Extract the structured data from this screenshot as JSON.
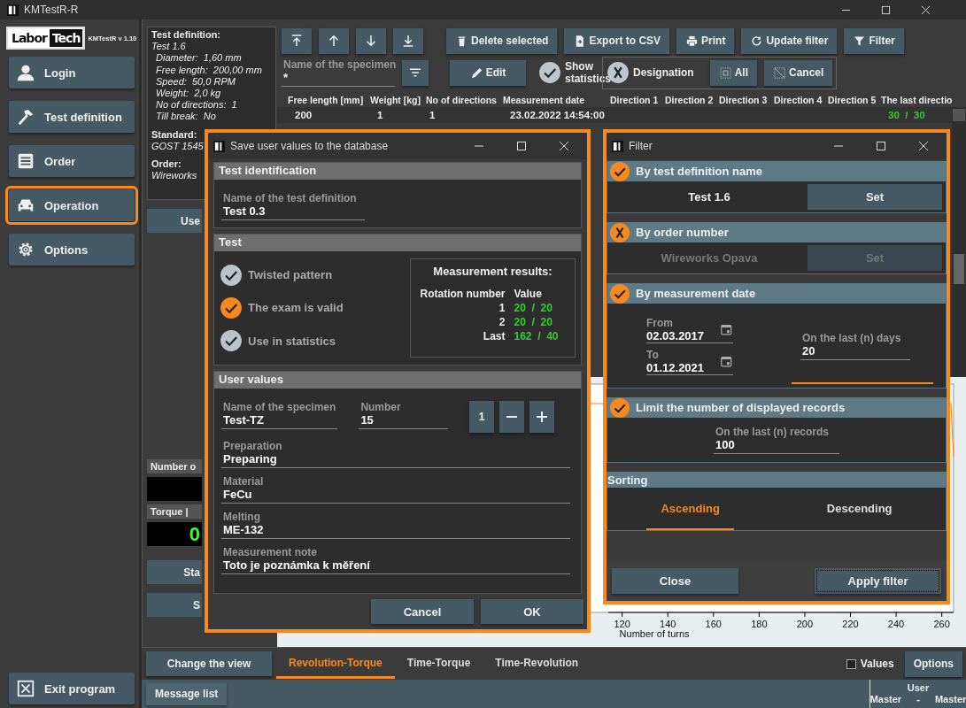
{
  "window": {
    "title": "KMTestR-R"
  },
  "sidebar": {
    "logo_left": "Labor",
    "logo_right": "Tech",
    "version": "KMTestR v 1.10",
    "items": [
      {
        "label": "Login",
        "selected": false
      },
      {
        "label": "Test definition",
        "selected": false
      },
      {
        "label": "Order",
        "selected": false
      },
      {
        "label": "Operation",
        "selected": true
      },
      {
        "label": "Options",
        "selected": false
      }
    ],
    "exit": "Exit program"
  },
  "info": {
    "heading": "Test definition:",
    "name": "Test 1.6",
    "lines": [
      "Diameter:  1,60 mm",
      "Free length:  200,00 mm",
      "Speed:  50,0 RPM",
      "Weight:  2,0 kg",
      "No of directions:  1",
      "Till break:  No"
    ],
    "standard_label": "Standard:",
    "standard": "GOST 1545",
    "order_label": "Order:",
    "order": "Wireworks"
  },
  "left_panel": {
    "button": "Use",
    "readouts": [
      {
        "label": "Number o"
      },
      {
        "label": "Torque |",
        "value": "0"
      }
    ],
    "buttons": [
      "Sta",
      "S"
    ]
  },
  "toolbar": {
    "buttons": [
      "Delete selected",
      "Export to CSV",
      "Print",
      "Update filter",
      "Filter"
    ],
    "specimen_field": {
      "label": "Name of the specimen",
      "value": "*"
    },
    "edit": "Edit",
    "show_statistics": {
      "label": "Show statistics",
      "checked": true
    },
    "designation": {
      "label": "Designation",
      "checked": false
    },
    "all": "All",
    "cancel": "Cancel"
  },
  "table": {
    "columns": [
      "Free length [mm]",
      "Weight [kg]",
      "No of directions",
      "Measurement date",
      "Direction 1",
      "Direction 2",
      "Direction 3",
      "Direction 4",
      "Direction 5",
      "The last directio"
    ],
    "rows": [
      {
        "free_length": "200",
        "weight": "1",
        "directions": "1",
        "date": "23.02.2022 14:54:00",
        "last": "30  /  30"
      }
    ]
  },
  "plot": {
    "xticks": [
      "120",
      "140",
      "160",
      "180",
      "200",
      "220",
      "240",
      "260"
    ],
    "xlabel": "Number of turns"
  },
  "bottom": {
    "change_view": "Change the view",
    "tabs": [
      {
        "label": "Revolution-Torque",
        "selected": true
      },
      {
        "label": "Time-Torque",
        "selected": false
      },
      {
        "label": "Time-Revolution",
        "selected": false
      }
    ],
    "values": {
      "label": "Values",
      "checked": false
    },
    "options": "Options"
  },
  "status_bar": {
    "message_list": "Message list",
    "user_label": "User",
    "user": "Master - Master"
  },
  "save_dialog": {
    "title": "Save user values to the database",
    "identification": {
      "heading": "Test identification",
      "field": {
        "label": "Name of the test definition",
        "value": "Test 0.3"
      }
    },
    "test": {
      "heading": "Test",
      "checks": [
        {
          "label": "Twisted pattern",
          "checked": false
        },
        {
          "label": "The exam is valid",
          "checked": true
        },
        {
          "label": "Use in statistics",
          "checked": false
        }
      ],
      "results": {
        "title": "Measurement results:",
        "columns": [
          "Rotation number",
          "Value"
        ],
        "rows": [
          {
            "rotation": "1",
            "value": "20  /  20"
          },
          {
            "rotation": "2",
            "value": "20  /  20"
          },
          {
            "rotation": "Last",
            "value": "162  /  40"
          }
        ]
      }
    },
    "user_values": {
      "heading": "User values",
      "specimen": {
        "label": "Name of the specimen",
        "value": "Test-TZ"
      },
      "number": {
        "label": "Number",
        "value": "15"
      },
      "step": "1",
      "fields": [
        {
          "label": "Preparation",
          "value": "Preparing"
        },
        {
          "label": "Material",
          "value": "FeCu"
        },
        {
          "label": "Melting",
          "value": "ME-132"
        },
        {
          "label": "Measurement note",
          "value": "Toto je poznámka k měření"
        }
      ]
    },
    "buttons": [
      "Cancel",
      "OK"
    ]
  },
  "filter_dialog": {
    "title": "Filter",
    "sections": [
      {
        "kind": "value",
        "heading": "By test definition name",
        "enabled": true,
        "value": "Test 1.6",
        "button": "Set"
      },
      {
        "kind": "value",
        "heading": "By order number",
        "enabled": false,
        "value": "Wireworks Opava",
        "button": "Set"
      },
      {
        "kind": "dates",
        "heading": "By measurement date",
        "enabled": true,
        "from": {
          "label": "From",
          "value": "02.03.2017"
        },
        "to": {
          "label": "To",
          "value": "01.12.2021"
        },
        "days": {
          "label": "On the last (n) days",
          "value": "20"
        }
      },
      {
        "kind": "count",
        "heading": "Limit the number of displayed records",
        "enabled": true,
        "records": {
          "label": "On the last (n) records",
          "value": "100"
        }
      }
    ],
    "sorting": {
      "heading": "Sorting",
      "options": [
        {
          "label": "Ascending",
          "selected": true
        },
        {
          "label": "Descending",
          "selected": false
        }
      ]
    },
    "buttons": [
      {
        "label": "Close",
        "focused": false
      },
      {
        "label": "Apply filter",
        "focused": true
      }
    ]
  }
}
